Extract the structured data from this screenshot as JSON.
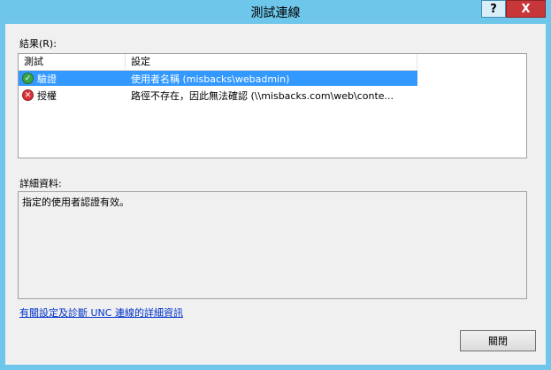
{
  "window": {
    "title": "測試連線",
    "help_label": "?",
    "close_label": "X"
  },
  "results": {
    "label": "結果(R):",
    "columns": [
      "測試",
      "設定"
    ],
    "rows": [
      {
        "test": "驗證",
        "setting": "使用者名稱 (misbacks\\webadmin)",
        "status": "success",
        "selected": true
      },
      {
        "test": "授權",
        "setting": "路徑不存在，因此無法確認 (\\\\misbacks.com\\web\\conte...",
        "status": "error",
        "selected": false
      }
    ]
  },
  "details": {
    "label": "詳細資料:",
    "text": "指定的使用者認證有效。"
  },
  "help_link": "有關設定及診斷 UNC 連線的詳細資訊",
  "buttons": {
    "close": "關閉"
  },
  "colors": {
    "titlebar": "#6ec6ea",
    "selection": "#3399ff",
    "link": "#0033cc",
    "close_button": "#c7373a"
  },
  "icons": {
    "success": "check-circle-icon",
    "error": "x-circle-icon"
  }
}
